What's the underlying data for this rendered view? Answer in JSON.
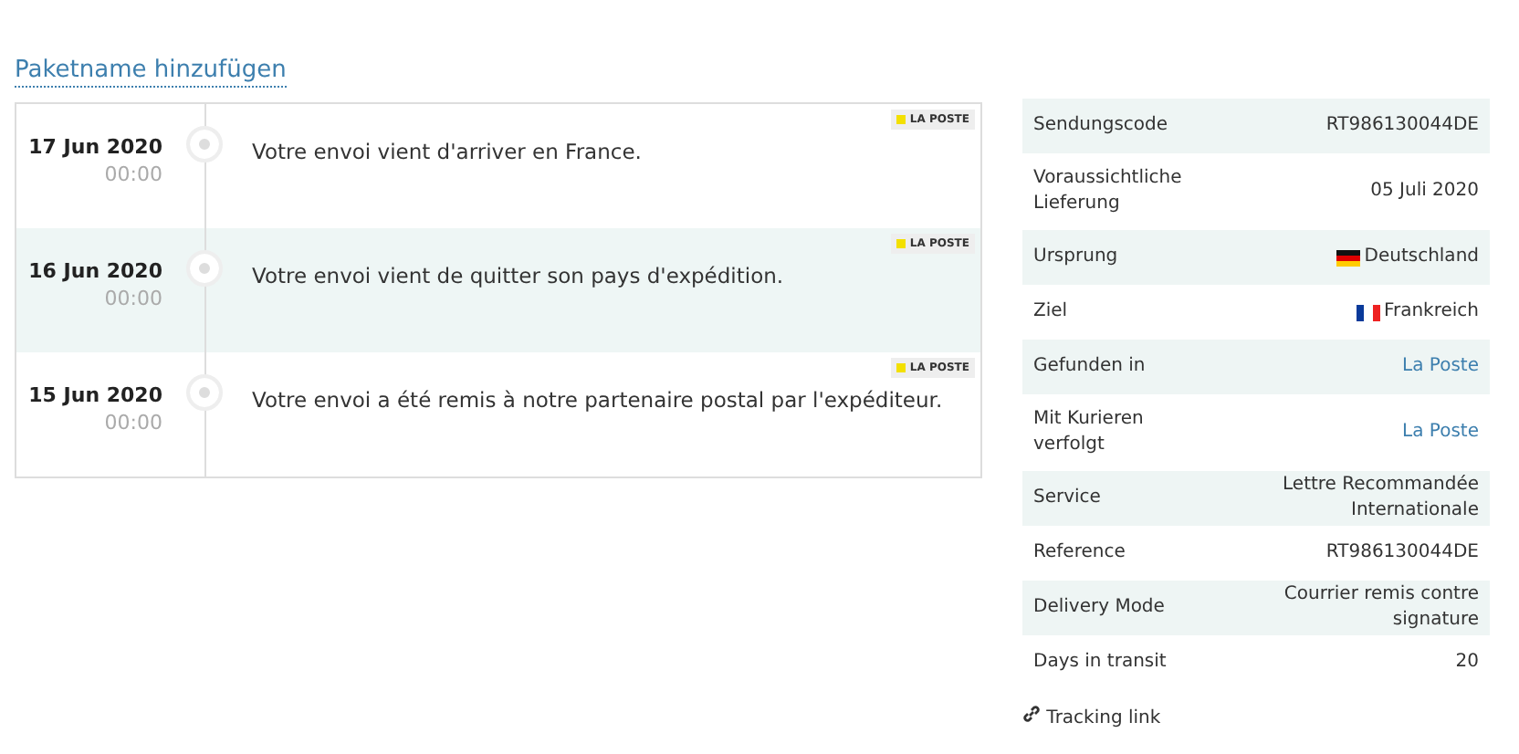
{
  "package_name_link": "Paketname hinzufügen",
  "events": [
    {
      "date": "17 Jun 2020",
      "time": "00:00",
      "text": "Votre envoi vient d'arriver en France.",
      "carrier": "LA POSTE",
      "highlighted": false
    },
    {
      "date": "16 Jun 2020",
      "time": "00:00",
      "text": "Votre envoi vient de quitter son pays d'expédition.",
      "carrier": "LA POSTE",
      "highlighted": true
    },
    {
      "date": "15 Jun 2020",
      "time": "00:00",
      "text": "Votre envoi a été remis à notre partenaire postal par l'expéditeur.",
      "carrier": "LA POSTE",
      "highlighted": false
    }
  ],
  "details": [
    {
      "label": "Sendungscode",
      "value": "RT986130044DE",
      "kind": "text"
    },
    {
      "label": "Voraussichtliche Lieferung",
      "value": "05 Juli 2020",
      "kind": "text"
    },
    {
      "label": "Ursprung",
      "value": "Deutschland",
      "kind": "flag_de"
    },
    {
      "label": "Ziel",
      "value": "Frankreich",
      "kind": "flag_fr"
    },
    {
      "label": "Gefunden in",
      "value": "La Poste",
      "kind": "link"
    },
    {
      "label": "Mit Kurieren verfolgt",
      "value": "La Poste",
      "kind": "link"
    },
    {
      "label": "Service",
      "value": "Lettre Recommandée Internationale",
      "kind": "text"
    },
    {
      "label": "Reference",
      "value": "RT986130044DE",
      "kind": "text"
    },
    {
      "label": "Delivery Mode",
      "value": "Courrier remis contre signature",
      "kind": "text"
    },
    {
      "label": "Days in transit",
      "value": "20",
      "kind": "text"
    }
  ],
  "tracking_link": "Tracking link"
}
